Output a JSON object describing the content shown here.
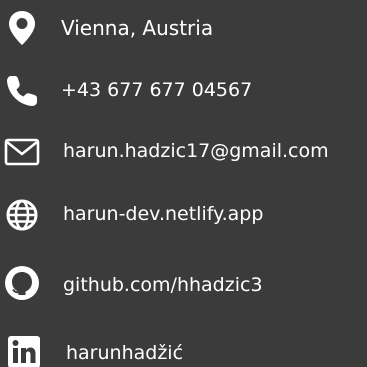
{
  "contacts": {
    "location": {
      "text": "Vienna, Austria",
      "icon": "location-pin-icon"
    },
    "phone": {
      "text": "+43 677 677 04567",
      "icon": "phone-icon"
    },
    "email": {
      "text": "harun.hadzic17@gmail.com",
      "icon": "envelope-icon"
    },
    "website": {
      "text": "harun-dev.netlify.app",
      "icon": "globe-icon"
    },
    "github": {
      "text": "github.com/hhadzic3",
      "icon": "github-icon"
    },
    "linkedin": {
      "text": "harunhadžić",
      "icon": "linkedin-icon"
    }
  },
  "colors": {
    "background": "#3b3b3b",
    "text": "#ffffff",
    "icon": "#ffffff"
  }
}
